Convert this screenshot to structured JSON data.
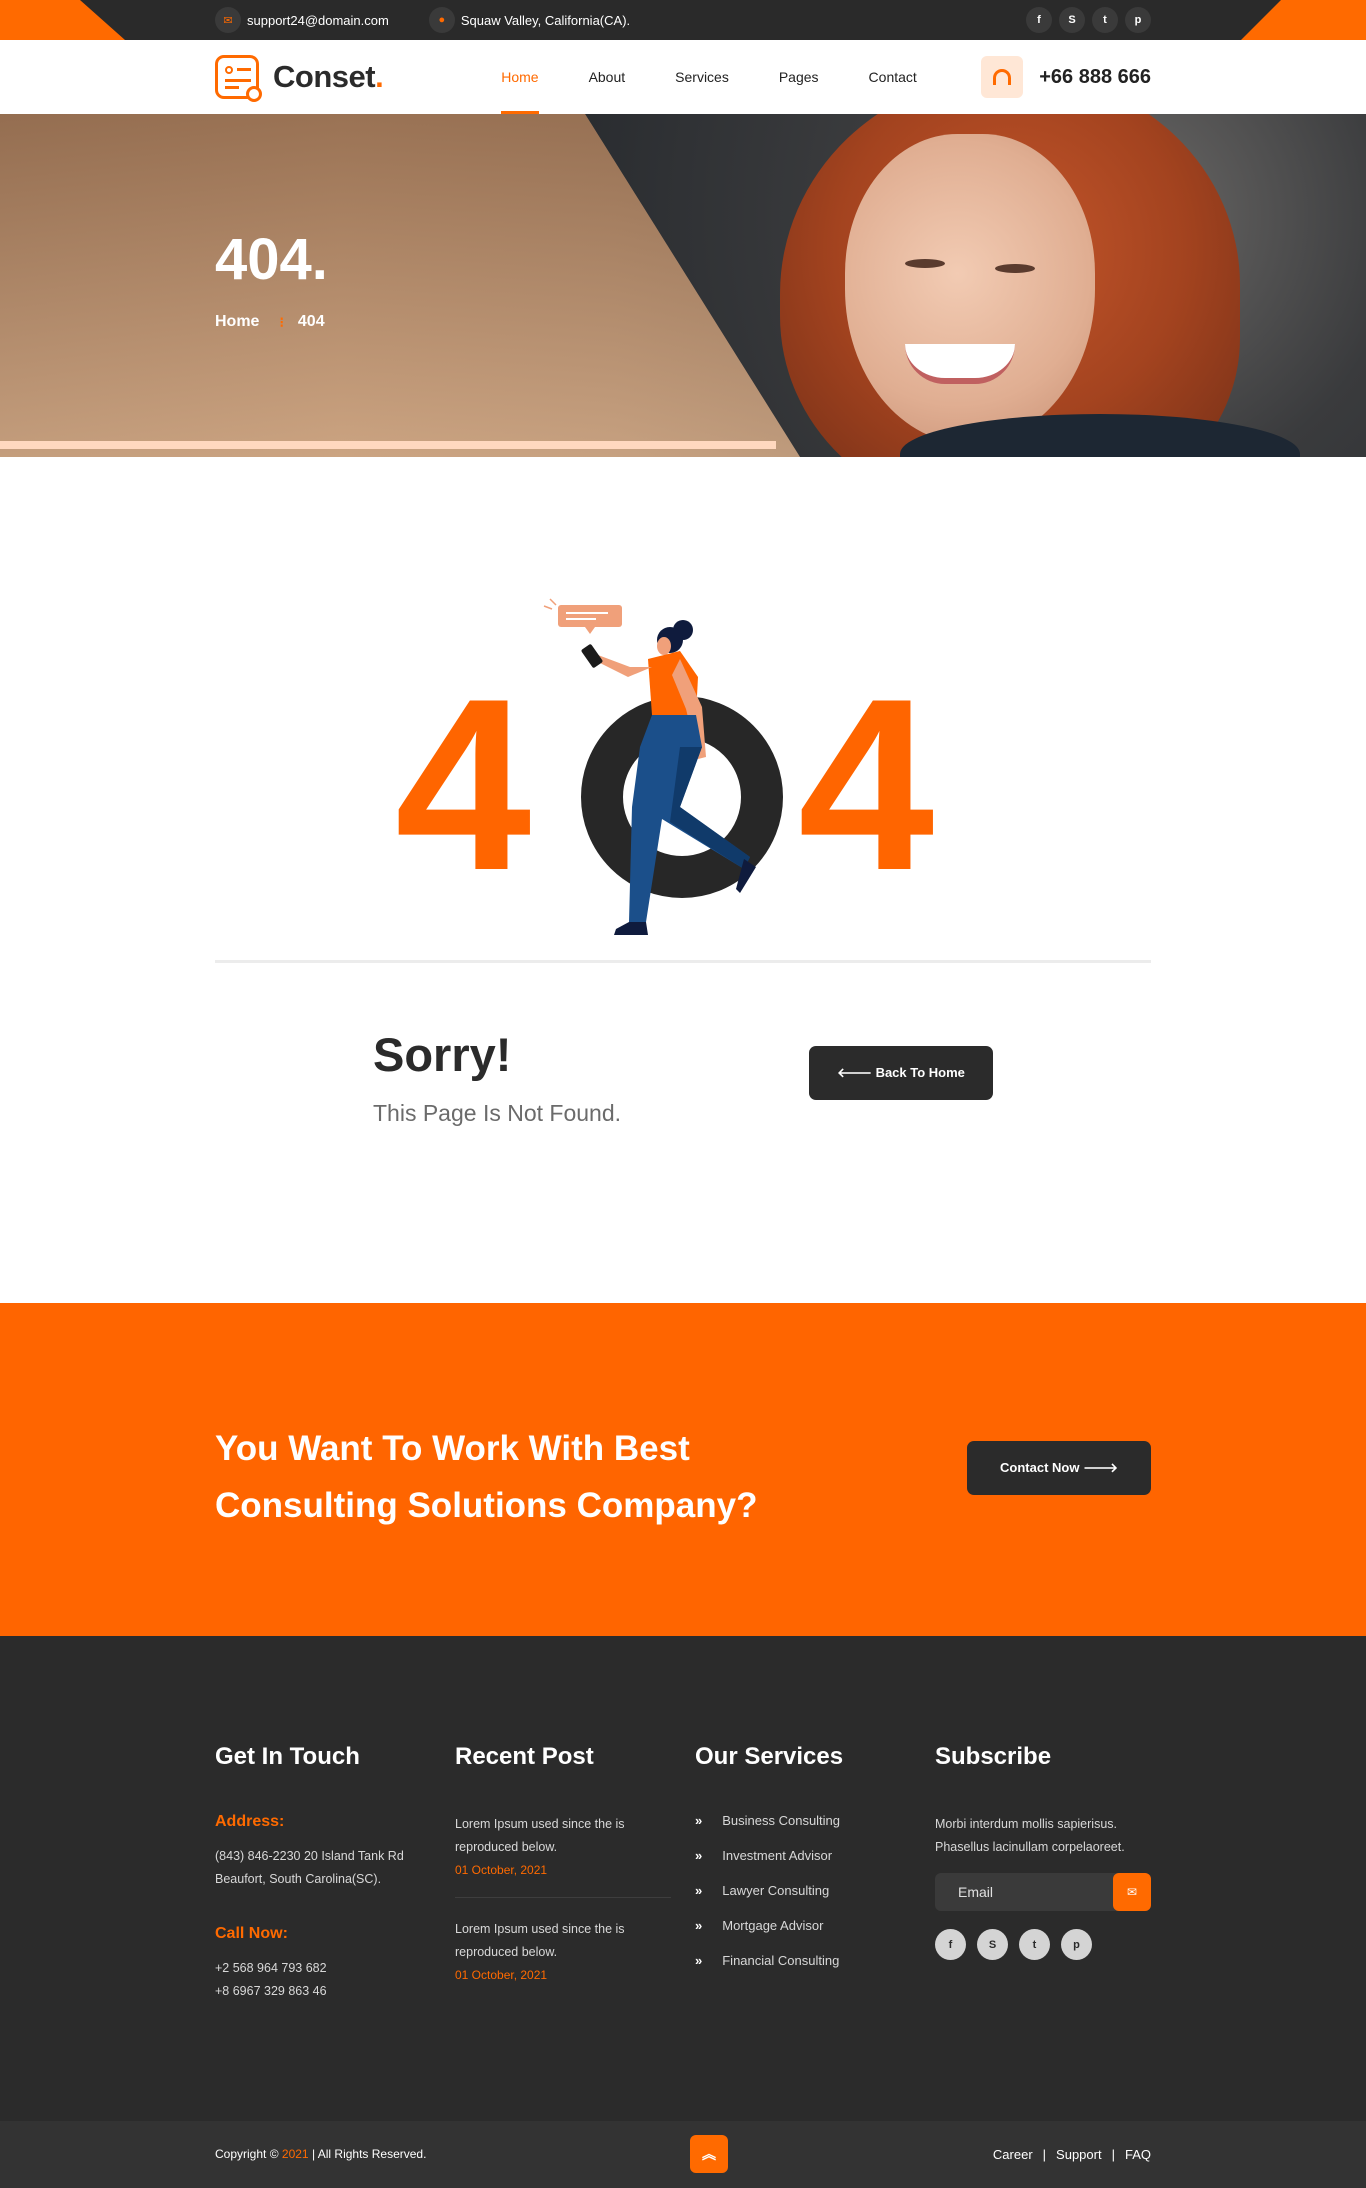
{
  "topbar": {
    "email": "support24@domain.com",
    "address": "Squaw Valley, California(CA).",
    "social": [
      {
        "icon": "facebook-icon",
        "glyph": "f"
      },
      {
        "icon": "skype-icon",
        "glyph": "S"
      },
      {
        "icon": "twitter-icon",
        "glyph": "t"
      },
      {
        "icon": "pinterest-icon",
        "glyph": "p"
      }
    ]
  },
  "header": {
    "logo_text": "Conset",
    "logo_dot": ".",
    "nav": [
      "Home",
      "About",
      "Services",
      "Pages",
      "Contact"
    ],
    "active_nav": "Home",
    "phone": "+66 888 666"
  },
  "hero": {
    "title": "404.",
    "breadcrumb_home": "Home",
    "breadcrumb_sep": "⁝",
    "breadcrumb_current": "404"
  },
  "error": {
    "digits": [
      "4",
      "0",
      "4"
    ],
    "heading": "Sorry!",
    "subheading": "This Page Is Not Found.",
    "back_button": "🡐 Back To Home"
  },
  "cta": {
    "text": "You Want To Work With Best Consulting Solutions Company?",
    "button": "Contact Now 🡒"
  },
  "footer": {
    "contact": {
      "title": "Get In Touch",
      "address_label": "Address:",
      "address_line1": "(843) 846-2230 20 Island Tank Rd",
      "address_line2": "Beaufort, South Carolina(SC).",
      "call_label": "Call Now:",
      "phone1": "+2 568 964 793 682",
      "phone2": "+8 6967 329 863 46"
    },
    "recent": {
      "title": "Recent Post",
      "posts": [
        {
          "text": "Lorem Ipsum used since the is reproduced below.",
          "date": "01 October, 2021"
        },
        {
          "text": "Lorem Ipsum used since the is reproduced below.",
          "date": "01 October, 2021"
        }
      ]
    },
    "services": {
      "title": "Our Services",
      "items": [
        "Business Consulting",
        "Investment Advisor",
        "Lawyer Consulting",
        "Mortgage Advisor",
        "Financial Consulting"
      ]
    },
    "subscribe": {
      "title": "Subscribe",
      "text": "Morbi interdum mollis sapierisus. Phasellus lacinullam corpelaoreet.",
      "placeholder": "Email"
    }
  },
  "bottom": {
    "copy_prefix": "Copyright ©",
    "year": "2021",
    "copy_suffix": "| All Rights Reserved.",
    "links": [
      "Career",
      "Support",
      "FAQ"
    ]
  },
  "colors": {
    "accent": "#ff6a00",
    "dark": "#2b2b2b",
    "jeans": "#1b4f8a"
  }
}
